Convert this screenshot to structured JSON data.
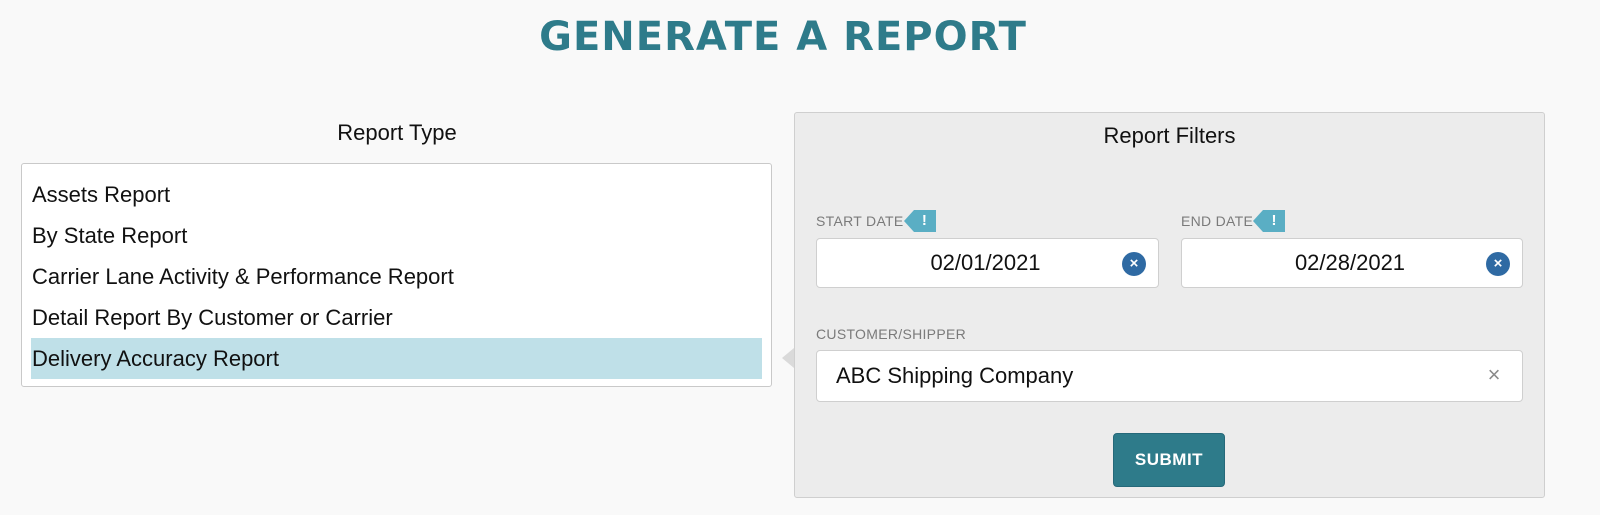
{
  "page": {
    "title": "GENERATE A REPORT"
  },
  "report_type": {
    "heading": "Report Type",
    "items": [
      {
        "label": "Assets Report",
        "selected": false
      },
      {
        "label": "By State Report",
        "selected": false
      },
      {
        "label": "Carrier Lane Activity & Performance Report",
        "selected": false
      },
      {
        "label": "Detail Report By Customer or Carrier",
        "selected": false
      },
      {
        "label": "Delivery Accuracy Report",
        "selected": true
      }
    ]
  },
  "filters": {
    "heading": "Report Filters",
    "start_date": {
      "label": "START DATE",
      "alert": "!",
      "value": "02/01/2021",
      "clear_glyph": "×"
    },
    "end_date": {
      "label": "END DATE",
      "alert": "!",
      "value": "02/28/2021",
      "clear_glyph": "×"
    },
    "customer": {
      "label": "CUSTOMER/SHIPPER",
      "value": "ABC Shipping Company",
      "clear_glyph": "×"
    },
    "submit_label": "SUBMIT"
  },
  "colors": {
    "accent": "#2e7b8a",
    "selected_row": "#bfe0e8",
    "alert_tag": "#5aaec4",
    "clear_button": "#2f6aa3"
  },
  "icons": {
    "alert": "exclamation-icon",
    "clear_date": "close-circle-icon",
    "clear_customer": "close-icon",
    "pointer": "caret-left-icon"
  }
}
